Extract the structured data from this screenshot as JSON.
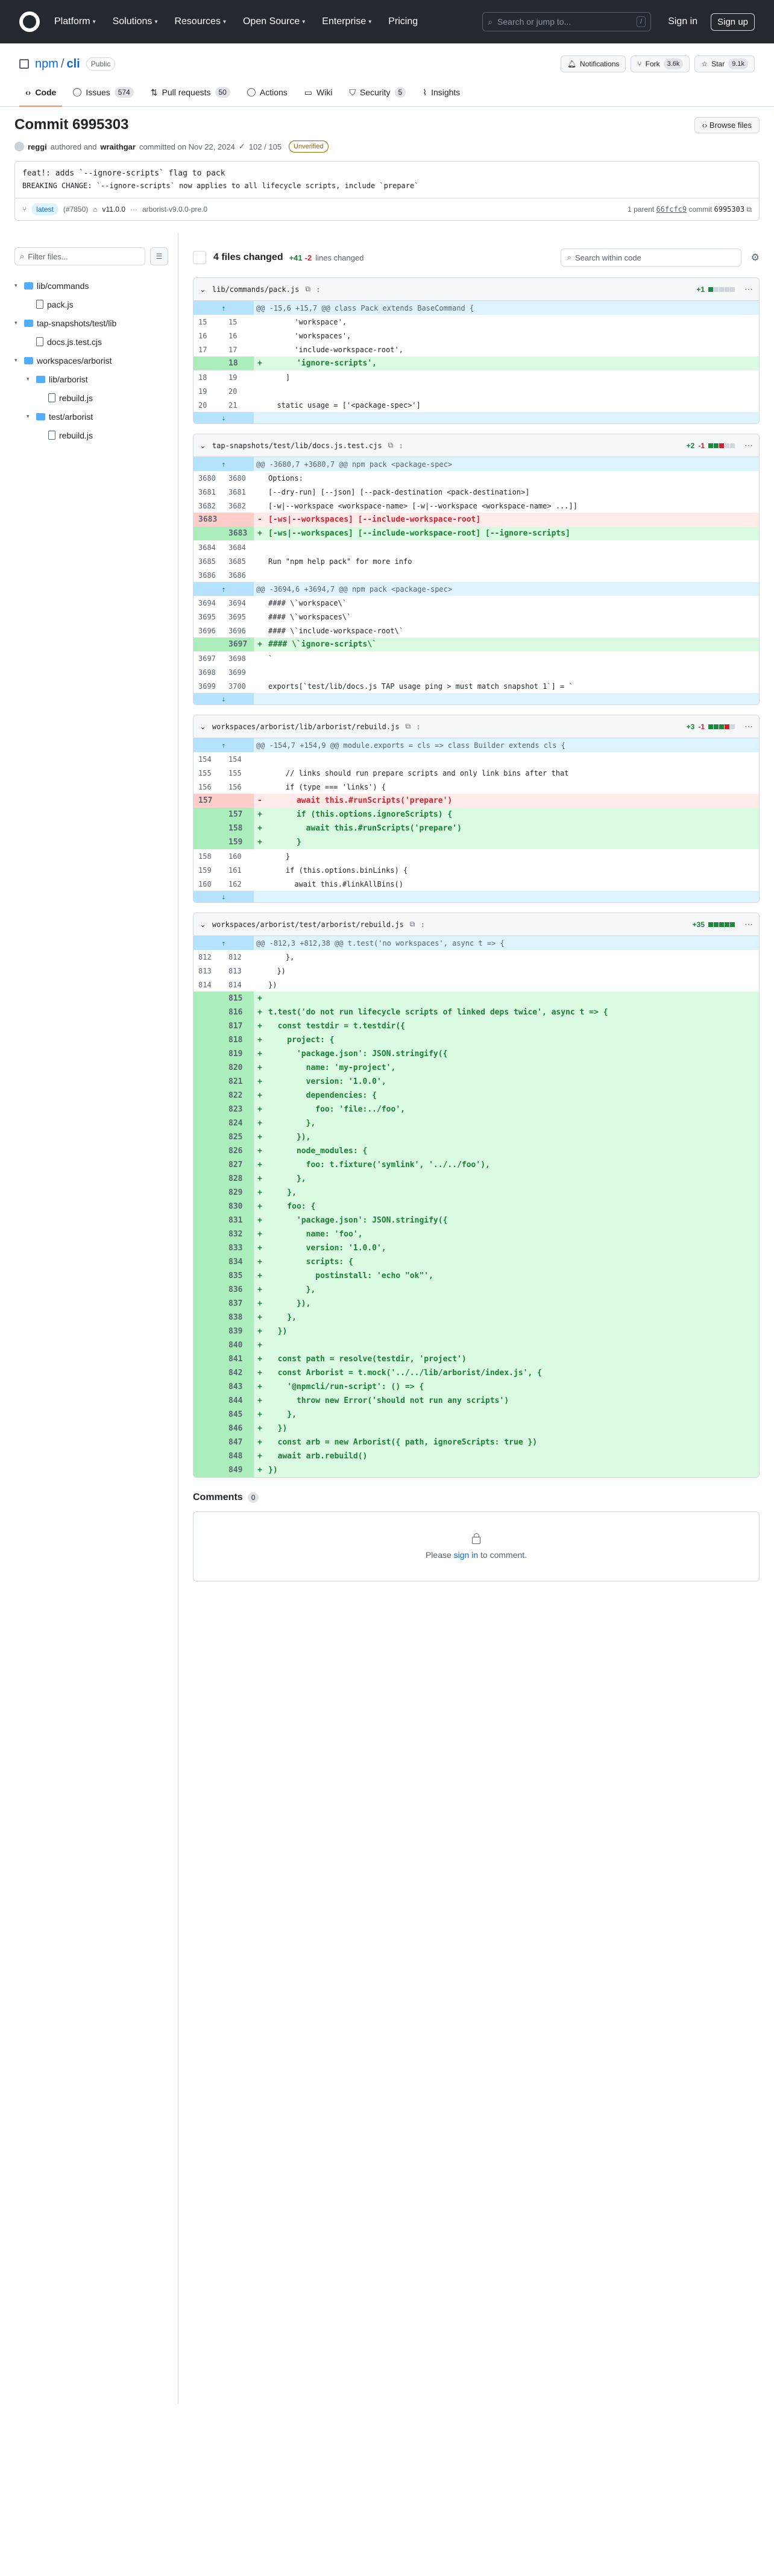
{
  "header": {
    "nav": [
      "Platform",
      "Solutions",
      "Resources",
      "Open Source",
      "Enterprise",
      "Pricing"
    ],
    "search_placeholder": "Search or jump to...",
    "search_key": "/",
    "sign_in": "Sign in",
    "sign_up": "Sign up"
  },
  "repo": {
    "owner": "npm",
    "name": "cli",
    "visibility": "Public",
    "notifications": "Notifications",
    "fork_label": "Fork",
    "fork_count": "3.6k",
    "star_label": "Star",
    "star_count": "9.1k"
  },
  "tabs": [
    {
      "label": "Code",
      "count": ""
    },
    {
      "label": "Issues",
      "count": "574"
    },
    {
      "label": "Pull requests",
      "count": "50"
    },
    {
      "label": "Actions",
      "count": ""
    },
    {
      "label": "Wiki",
      "count": ""
    },
    {
      "label": "Security",
      "count": "5"
    },
    {
      "label": "Insights",
      "count": ""
    }
  ],
  "commit": {
    "title": "Commit 6995303",
    "browse_files": "Browse files",
    "author": "reggi",
    "authored_text": "authored and",
    "committer": "wraithgar",
    "committed_text": "committed on Nov 22, 2024",
    "checks": "102 / 105",
    "verification": "Unverified",
    "message_title": "feat!: adds `--ignore-scripts` flag to pack",
    "message_body": "BREAKING CHANGE: `--ignore-scripts` now applies to all lifecycle scripts, include `prepare`",
    "tag_latest": "latest",
    "pr_ref": "(#7850)",
    "tag_range": "v11.0.0",
    "tag_ellipsis": "···",
    "tag_end": "arborist-v9.0.0-pre.0",
    "parent_label": "1 parent",
    "parent_sha": "66fcfc9",
    "commit_label": "commit",
    "commit_sha": "6995303"
  },
  "sidebar": {
    "filter_placeholder": "Filter files...",
    "tree": [
      {
        "type": "folder",
        "label": "lib/commands",
        "depth": 0
      },
      {
        "type": "file",
        "label": "pack.js",
        "depth": 1
      },
      {
        "type": "folder",
        "label": "tap-snapshots/test/lib",
        "depth": 0
      },
      {
        "type": "file",
        "label": "docs.js.test.cjs",
        "depth": 1
      },
      {
        "type": "folder",
        "label": "workspaces/arborist",
        "depth": 0
      },
      {
        "type": "folder",
        "label": "lib/arborist",
        "depth": 1
      },
      {
        "type": "file",
        "label": "rebuild.js",
        "depth": 2
      },
      {
        "type": "folder",
        "label": "test/arborist",
        "depth": 1
      },
      {
        "type": "file",
        "label": "rebuild.js",
        "depth": 2
      }
    ]
  },
  "summary": {
    "files_changed": "4 files changed",
    "additions": "+41",
    "deletions": "-2",
    "lines_changed": "lines changed",
    "search_placeholder": "Search within code"
  },
  "files": [
    {
      "path": "lib/commands/pack.js",
      "add": "+1",
      "del": "",
      "blocks": [
        "g",
        "n",
        "n",
        "n",
        "n"
      ],
      "rows": [
        {
          "t": "hunk",
          "o": "",
          "n": "",
          "m": "",
          "c": "@@ -15,6 +15,7 @@ class Pack extends BaseCommand {"
        },
        {
          "t": "ctx",
          "o": "15",
          "n": "15",
          "m": "",
          "c": "      'workspace',"
        },
        {
          "t": "ctx",
          "o": "16",
          "n": "16",
          "m": "",
          "c": "      'workspaces',"
        },
        {
          "t": "ctx",
          "o": "17",
          "n": "17",
          "m": "",
          "c": "      'include-workspace-root',"
        },
        {
          "t": "add",
          "o": "",
          "n": "18",
          "m": "+",
          "c": "      'ignore-scripts',"
        },
        {
          "t": "ctx",
          "o": "18",
          "n": "19",
          "m": "",
          "c": "    ]"
        },
        {
          "t": "ctx",
          "o": "19",
          "n": "20",
          "m": "",
          "c": ""
        },
        {
          "t": "ctx",
          "o": "20",
          "n": "21",
          "m": "",
          "c": "  static usage = ['<package-spec>']"
        },
        {
          "t": "end",
          "o": "",
          "n": "",
          "m": "",
          "c": ""
        }
      ]
    },
    {
      "path": "tap-snapshots/test/lib/docs.js.test.cjs",
      "add": "+2",
      "del": "-1",
      "blocks": [
        "g",
        "g",
        "r",
        "n",
        "n"
      ],
      "rows": [
        {
          "t": "hunk",
          "o": "",
          "n": "",
          "m": "",
          "c": "@@ -3680,7 +3680,7 @@ npm pack <package-spec>"
        },
        {
          "t": "ctx",
          "o": "3680",
          "n": "3680",
          "m": "",
          "c": "Options:"
        },
        {
          "t": "ctx",
          "o": "3681",
          "n": "3681",
          "m": "",
          "c": "[--dry-run] [--json] [--pack-destination <pack-destination>]"
        },
        {
          "t": "ctx",
          "o": "3682",
          "n": "3682",
          "m": "",
          "c": "[-w|--workspace <workspace-name> [-w|--workspace <workspace-name> ...]]"
        },
        {
          "t": "del",
          "o": "3683",
          "n": "",
          "m": "-",
          "c": "[-ws|--workspaces] [--include-workspace-root]"
        },
        {
          "t": "add",
          "o": "",
          "n": "3683",
          "m": "+",
          "c": "[-ws|--workspaces] [--include-workspace-root] [--ignore-scripts]"
        },
        {
          "t": "ctx",
          "o": "3684",
          "n": "3684",
          "m": "",
          "c": ""
        },
        {
          "t": "ctx",
          "o": "3685",
          "n": "3685",
          "m": "",
          "c": "Run \"npm help pack\" for more info"
        },
        {
          "t": "ctx",
          "o": "3686",
          "n": "3686",
          "m": "",
          "c": ""
        },
        {
          "t": "hunk",
          "o": "",
          "n": "",
          "m": "",
          "c": "@@ -3694,6 +3694,7 @@ npm pack <package-spec>"
        },
        {
          "t": "ctx",
          "o": "3694",
          "n": "3694",
          "m": "",
          "c": "#### \\`workspace\\`"
        },
        {
          "t": "ctx",
          "o": "3695",
          "n": "3695",
          "m": "",
          "c": "#### \\`workspaces\\`"
        },
        {
          "t": "ctx",
          "o": "3696",
          "n": "3696",
          "m": "",
          "c": "#### \\`include-workspace-root\\`"
        },
        {
          "t": "add",
          "o": "",
          "n": "3697",
          "m": "+",
          "c": "#### \\`ignore-scripts\\`"
        },
        {
          "t": "ctx",
          "o": "3697",
          "n": "3698",
          "m": "",
          "c": "`"
        },
        {
          "t": "ctx",
          "o": "3698",
          "n": "3699",
          "m": "",
          "c": ""
        },
        {
          "t": "ctx",
          "o": "3699",
          "n": "3700",
          "m": "",
          "c": "exports[`test/lib/docs.js TAP usage ping > must match snapshot 1`] = `"
        },
        {
          "t": "end",
          "o": "",
          "n": "",
          "m": "",
          "c": ""
        }
      ]
    },
    {
      "path": "workspaces/arborist/lib/arborist/rebuild.js",
      "add": "+3",
      "del": "-1",
      "blocks": [
        "g",
        "g",
        "g",
        "r",
        "n"
      ],
      "rows": [
        {
          "t": "hunk",
          "o": "",
          "n": "",
          "m": "",
          "c": "@@ -154,7 +154,9 @@ module.exports = cls => class Builder extends cls {"
        },
        {
          "t": "ctx",
          "o": "154",
          "n": "154",
          "m": "",
          "c": ""
        },
        {
          "t": "ctx",
          "o": "155",
          "n": "155",
          "m": "",
          "c": "    // links should run prepare scripts and only link bins after that"
        },
        {
          "t": "ctx",
          "o": "156",
          "n": "156",
          "m": "",
          "c": "    if (type === 'links') {"
        },
        {
          "t": "del",
          "o": "157",
          "n": "",
          "m": "-",
          "c": "      await this.#runScripts('prepare')"
        },
        {
          "t": "add",
          "o": "",
          "n": "157",
          "m": "+",
          "c": "      if (this.options.ignoreScripts) {"
        },
        {
          "t": "add",
          "o": "",
          "n": "158",
          "m": "+",
          "c": "        await this.#runScripts('prepare')"
        },
        {
          "t": "add",
          "o": "",
          "n": "159",
          "m": "+",
          "c": "      }"
        },
        {
          "t": "ctx",
          "o": "158",
          "n": "160",
          "m": "",
          "c": "    }"
        },
        {
          "t": "ctx",
          "o": "159",
          "n": "161",
          "m": "",
          "c": "    if (this.options.binLinks) {"
        },
        {
          "t": "ctx",
          "o": "160",
          "n": "162",
          "m": "",
          "c": "      await this.#linkAllBins()"
        },
        {
          "t": "end",
          "o": "",
          "n": "",
          "m": "",
          "c": ""
        }
      ]
    },
    {
      "path": "workspaces/arborist/test/arborist/rebuild.js",
      "add": "+35",
      "del": "",
      "blocks": [
        "g",
        "g",
        "g",
        "g",
        "g"
      ],
      "rows": [
        {
          "t": "hunk",
          "o": "",
          "n": "",
          "m": "",
          "c": "@@ -812,3 +812,38 @@ t.test('no workspaces', async t => {"
        },
        {
          "t": "ctx",
          "o": "812",
          "n": "812",
          "m": "",
          "c": "    },"
        },
        {
          "t": "ctx",
          "o": "813",
          "n": "813",
          "m": "",
          "c": "  })"
        },
        {
          "t": "ctx",
          "o": "814",
          "n": "814",
          "m": "",
          "c": "})"
        },
        {
          "t": "add",
          "o": "",
          "n": "815",
          "m": "+",
          "c": ""
        },
        {
          "t": "add",
          "o": "",
          "n": "816",
          "m": "+",
          "c": "t.test('do not run lifecycle scripts of linked deps twice', async t => {"
        },
        {
          "t": "add",
          "o": "",
          "n": "817",
          "m": "+",
          "c": "  const testdir = t.testdir({"
        },
        {
          "t": "add",
          "o": "",
          "n": "818",
          "m": "+",
          "c": "    project: {"
        },
        {
          "t": "add",
          "o": "",
          "n": "819",
          "m": "+",
          "c": "      'package.json': JSON.stringify({"
        },
        {
          "t": "add",
          "o": "",
          "n": "820",
          "m": "+",
          "c": "        name: 'my-project',"
        },
        {
          "t": "add",
          "o": "",
          "n": "821",
          "m": "+",
          "c": "        version: '1.0.0',"
        },
        {
          "t": "add",
          "o": "",
          "n": "822",
          "m": "+",
          "c": "        dependencies: {"
        },
        {
          "t": "add",
          "o": "",
          "n": "823",
          "m": "+",
          "c": "          foo: 'file:../foo',"
        },
        {
          "t": "add",
          "o": "",
          "n": "824",
          "m": "+",
          "c": "        },"
        },
        {
          "t": "add",
          "o": "",
          "n": "825",
          "m": "+",
          "c": "      }),"
        },
        {
          "t": "add",
          "o": "",
          "n": "826",
          "m": "+",
          "c": "      node_modules: {"
        },
        {
          "t": "add",
          "o": "",
          "n": "827",
          "m": "+",
          "c": "        foo: t.fixture('symlink', '../../foo'),"
        },
        {
          "t": "add",
          "o": "",
          "n": "828",
          "m": "+",
          "c": "      },"
        },
        {
          "t": "add",
          "o": "",
          "n": "829",
          "m": "+",
          "c": "    },"
        },
        {
          "t": "add",
          "o": "",
          "n": "830",
          "m": "+",
          "c": "    foo: {"
        },
        {
          "t": "add",
          "o": "",
          "n": "831",
          "m": "+",
          "c": "      'package.json': JSON.stringify({"
        },
        {
          "t": "add",
          "o": "",
          "n": "832",
          "m": "+",
          "c": "        name: 'foo',"
        },
        {
          "t": "add",
          "o": "",
          "n": "833",
          "m": "+",
          "c": "        version: '1.0.0',"
        },
        {
          "t": "add",
          "o": "",
          "n": "834",
          "m": "+",
          "c": "        scripts: {"
        },
        {
          "t": "add",
          "o": "",
          "n": "835",
          "m": "+",
          "c": "          postinstall: 'echo \"ok\"',"
        },
        {
          "t": "add",
          "o": "",
          "n": "836",
          "m": "+",
          "c": "        },"
        },
        {
          "t": "add",
          "o": "",
          "n": "837",
          "m": "+",
          "c": "      }),"
        },
        {
          "t": "add",
          "o": "",
          "n": "838",
          "m": "+",
          "c": "    },"
        },
        {
          "t": "add",
          "o": "",
          "n": "839",
          "m": "+",
          "c": "  })"
        },
        {
          "t": "add",
          "o": "",
          "n": "840",
          "m": "+",
          "c": ""
        },
        {
          "t": "add",
          "o": "",
          "n": "841",
          "m": "+",
          "c": "  const path = resolve(testdir, 'project')"
        },
        {
          "t": "add",
          "o": "",
          "n": "842",
          "m": "+",
          "c": "  const Arborist = t.mock('../../lib/arborist/index.js', {"
        },
        {
          "t": "add",
          "o": "",
          "n": "843",
          "m": "+",
          "c": "    '@npmcli/run-script': () => {"
        },
        {
          "t": "add",
          "o": "",
          "n": "844",
          "m": "+",
          "c": "      throw new Error('should not run any scripts')"
        },
        {
          "t": "add",
          "o": "",
          "n": "845",
          "m": "+",
          "c": "    },"
        },
        {
          "t": "add",
          "o": "",
          "n": "846",
          "m": "+",
          "c": "  })"
        },
        {
          "t": "add",
          "o": "",
          "n": "847",
          "m": "+",
          "c": "  const arb = new Arborist({ path, ignoreScripts: true })"
        },
        {
          "t": "add",
          "o": "",
          "n": "848",
          "m": "+",
          "c": "  await arb.rebuild()"
        },
        {
          "t": "add",
          "o": "",
          "n": "849",
          "m": "+",
          "c": "})"
        }
      ]
    }
  ],
  "comments": {
    "title": "Comments",
    "count": "0",
    "prefix": "Please",
    "link": "sign in",
    "suffix": "to comment."
  }
}
